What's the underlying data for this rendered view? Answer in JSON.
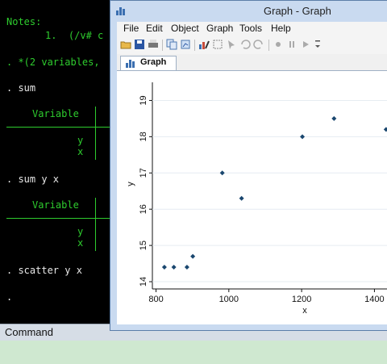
{
  "console": {
    "notes_label": "Notes:",
    "note1": "1.  (/v# c",
    "vars_line": ". *(2 variables,",
    "cmd_sum": ". sum",
    "variable_header": "Variable",
    "var_y": "y",
    "var_x": "x",
    "cmd_sum_yx": ". sum y x",
    "variable_header2": "Variable",
    "var_y2": "y",
    "var_x2": "x",
    "cmd_scatter": ". scatter y x",
    "prompt": "."
  },
  "command_panel": {
    "label": "Command"
  },
  "graph_window": {
    "title": "Graph - Graph",
    "menu": [
      "File",
      "Edit",
      "Object",
      "Graph",
      "Tools",
      "Help"
    ],
    "tab_label": "Graph"
  },
  "chart_data": {
    "type": "scatter",
    "xlabel": "x",
    "ylabel": "y",
    "xlim": [
      790,
      1450
    ],
    "ylim": [
      13.8,
      19.5
    ],
    "xticks": [
      800,
      1000,
      1200,
      1400
    ],
    "yticks": [
      14,
      15,
      16,
      17,
      18,
      19
    ],
    "points": [
      {
        "x": 823,
        "y": 14.4
      },
      {
        "x": 849,
        "y": 14.4
      },
      {
        "x": 885,
        "y": 14.4
      },
      {
        "x": 901,
        "y": 14.7
      },
      {
        "x": 982,
        "y": 17.0
      },
      {
        "x": 1035,
        "y": 16.3
      },
      {
        "x": 1202,
        "y": 18.0
      },
      {
        "x": 1289,
        "y": 18.5
      },
      {
        "x": 1432,
        "y": 18.2
      }
    ],
    "marker_color": "#1a476f"
  }
}
